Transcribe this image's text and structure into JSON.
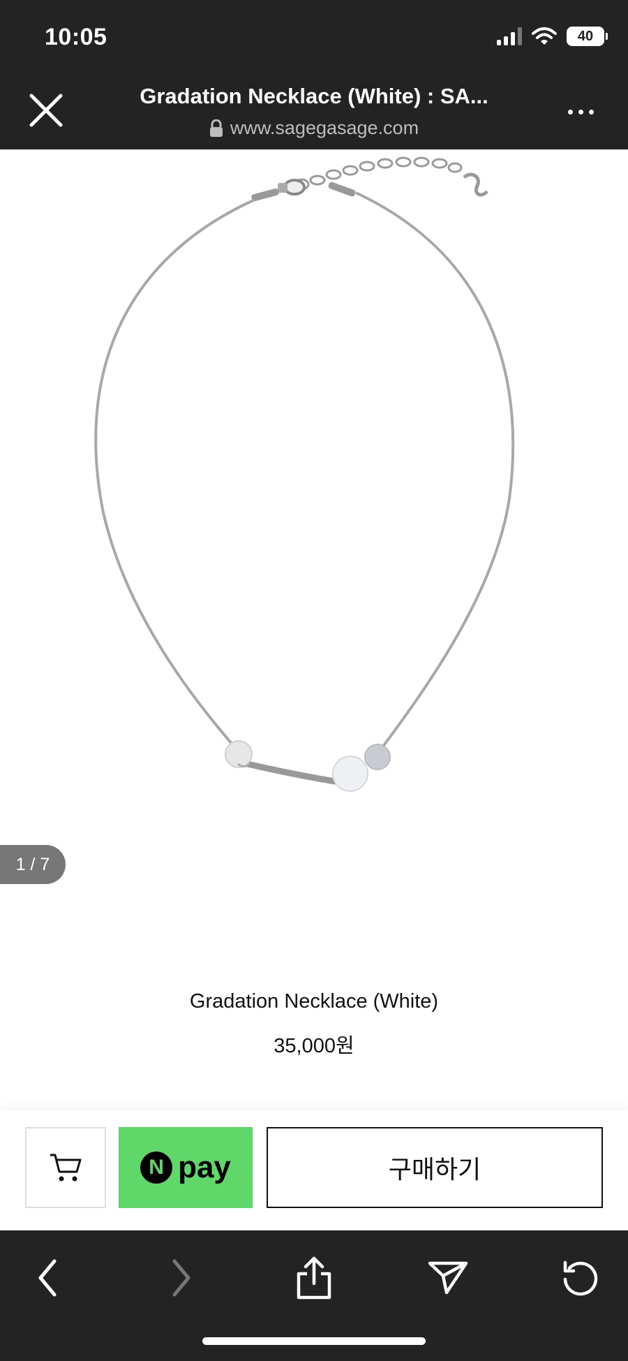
{
  "status_bar": {
    "time": "10:05",
    "battery": "40"
  },
  "browser": {
    "title": "Gradation Necklace (White) : SA...",
    "url": "www.sagegasage.com"
  },
  "gallery": {
    "pager": "1 / 7"
  },
  "product": {
    "name": "Gradation Necklace (White)",
    "price": "35,000원"
  },
  "purchase_bar": {
    "npay_logo": "N",
    "npay_label": "pay",
    "order_label": "구매하기",
    "npay_color": "#5fd869"
  },
  "icons": [
    "close-icon",
    "lock-icon",
    "more-icon",
    "cart-icon",
    "back-icon",
    "forward-icon",
    "share-icon",
    "send-icon",
    "reload-icon"
  ]
}
